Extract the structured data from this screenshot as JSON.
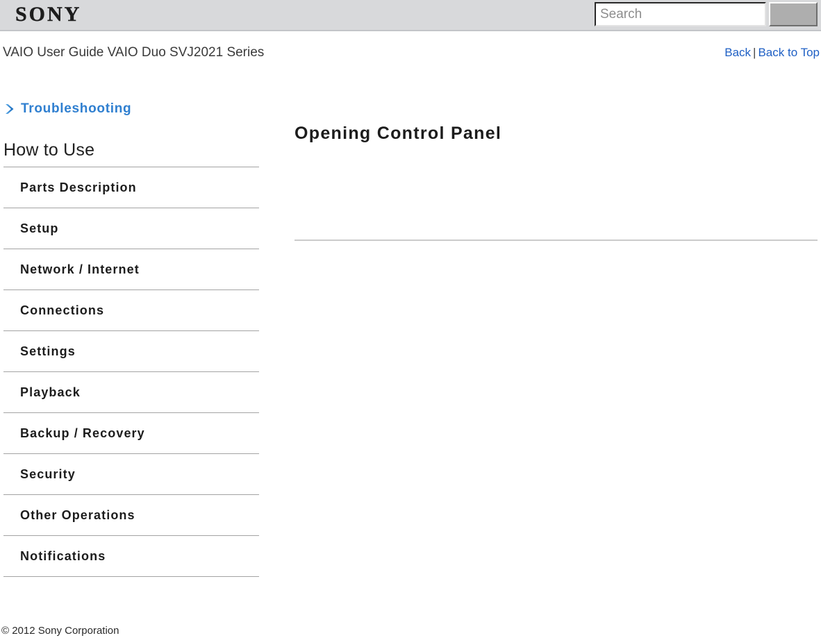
{
  "header": {
    "logo_text": "SONY",
    "logo_icon": "sony-wordmark",
    "search": {
      "placeholder": "Search",
      "value": "",
      "button_label": "",
      "button_icon": "search-button-image"
    }
  },
  "subheader": {
    "guide_title": "VAIO User Guide VAIO Duo SVJ2021 Series",
    "links": {
      "back": "Back",
      "separator": "|",
      "back_to_top": "Back to Top"
    }
  },
  "sidebar": {
    "troubleshooting": {
      "label": "Troubleshooting",
      "icon": "chevron-right-icon"
    },
    "section_heading": "How to Use",
    "items": [
      {
        "label": "Parts Description"
      },
      {
        "label": "Setup"
      },
      {
        "label": "Network / Internet"
      },
      {
        "label": "Connections"
      },
      {
        "label": "Settings"
      },
      {
        "label": "Playback"
      },
      {
        "label": "Backup / Recovery"
      },
      {
        "label": "Security"
      },
      {
        "label": "Other Operations"
      },
      {
        "label": "Notifications"
      }
    ]
  },
  "main": {
    "page_title": "Opening Control Panel",
    "body_text": ""
  },
  "footer": {
    "copyright": "© 2012 Sony Corporation"
  },
  "colors": {
    "header_bg": "#d8d9db",
    "link_blue": "#1e5fc4",
    "accent_blue": "#2f7fd0",
    "divider": "#a3a3a3",
    "rule": "#cbcbcb",
    "text": "#1c1c1c"
  }
}
